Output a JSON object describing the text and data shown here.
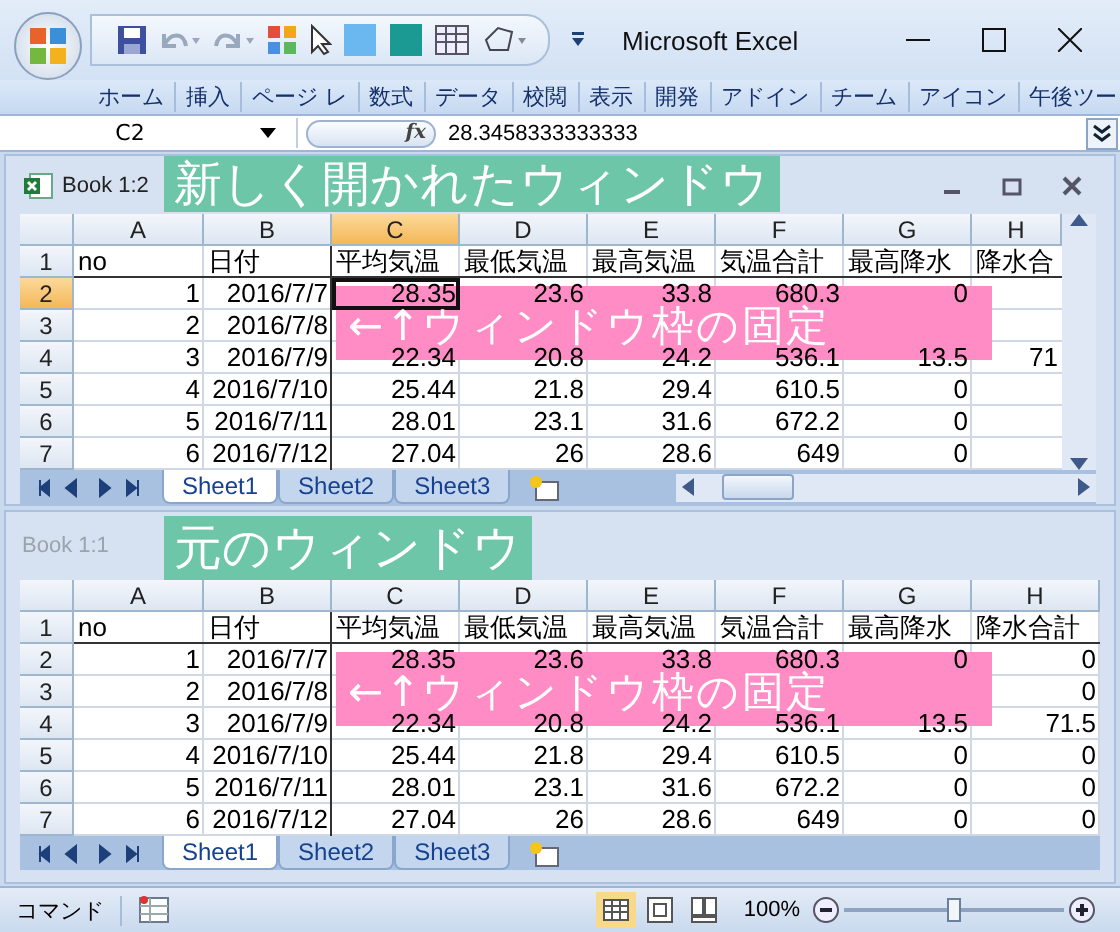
{
  "app": {
    "title": "Microsoft Excel"
  },
  "ribbon_tabs": [
    "ホーム",
    "挿入",
    "ページ レ",
    "数式",
    "データ",
    "校閲",
    "表示",
    "開発",
    "アドイン",
    "チーム",
    "アイコン",
    "午後ツー"
  ],
  "formula_bar": {
    "name_box": "C2",
    "fx": "fx",
    "value": "28.3458333333333"
  },
  "windows": [
    {
      "title": "Book 1:2",
      "active": true,
      "annotation": "新しく開かれたウィンドウ",
      "freeze_note": "←↑ウィンドウ枠の固定",
      "frozen_panes": true,
      "scrollbars": true,
      "columns": [
        {
          "label": "A",
          "selected": false
        },
        {
          "label": "B",
          "selected": false
        },
        {
          "label": "C",
          "selected": true
        },
        {
          "label": "D",
          "selected": false
        },
        {
          "label": "E",
          "selected": false
        },
        {
          "label": "F",
          "selected": false
        },
        {
          "label": "G",
          "selected": false
        },
        {
          "label": "H",
          "selected": false
        }
      ],
      "rows": [
        {
          "header": "1",
          "selected": false,
          "kind": "text",
          "cells": [
            "no",
            "日付",
            "平均気温",
            "最低気温",
            "最高気温",
            "気温合計",
            "最高降水",
            "降水合"
          ]
        },
        {
          "header": "2",
          "selected": true,
          "kind": "number",
          "cells": [
            "1",
            "2016/7/7",
            "28.35",
            "23.6",
            "33.8",
            "680.3",
            "0",
            null
          ]
        },
        {
          "header": "3",
          "selected": false,
          "kind": "number",
          "cells": [
            "2",
            "2016/7/8",
            null,
            null,
            null,
            null,
            null,
            null
          ]
        },
        {
          "header": "4",
          "selected": false,
          "kind": "number",
          "cells": [
            "3",
            "2016/7/9",
            "22.34",
            "20.8",
            "24.2",
            "536.1",
            "13.5",
            "71"
          ]
        },
        {
          "header": "5",
          "selected": false,
          "kind": "number",
          "cells": [
            "4",
            "2016/7/10",
            "25.44",
            "21.8",
            "29.4",
            "610.5",
            "0",
            null
          ]
        },
        {
          "header": "6",
          "selected": false,
          "kind": "number",
          "cells": [
            "5",
            "2016/7/11",
            "28.01",
            "23.1",
            "31.6",
            "672.2",
            "0",
            null
          ]
        },
        {
          "header": "7",
          "selected": false,
          "kind": "number",
          "cells": [
            "6",
            "2016/7/12",
            "27.04",
            "26",
            "28.6",
            "649",
            "0",
            null
          ]
        }
      ],
      "sheet_tabs": [
        {
          "label": "Sheet1",
          "selected": true
        },
        {
          "label": "Sheet2",
          "selected": false
        },
        {
          "label": "Sheet3",
          "selected": false
        }
      ]
    },
    {
      "title": "Book 1:1",
      "active": false,
      "annotation": "元のウィンドウ",
      "freeze_note": "←↑ウィンドウ枠の固定",
      "frozen_panes": true,
      "scrollbars": false,
      "columns": [
        {
          "label": "A",
          "selected": false
        },
        {
          "label": "B",
          "selected": false
        },
        {
          "label": "C",
          "selected": false
        },
        {
          "label": "D",
          "selected": false
        },
        {
          "label": "E",
          "selected": false
        },
        {
          "label": "F",
          "selected": false
        },
        {
          "label": "G",
          "selected": false
        },
        {
          "label": "H",
          "selected": false
        }
      ],
      "rows": [
        {
          "header": "1",
          "selected": false,
          "kind": "text",
          "cells": [
            "no",
            "日付",
            "平均気温",
            "最低気温",
            "最高気温",
            "気温合計",
            "最高降水",
            "降水合計"
          ]
        },
        {
          "header": "2",
          "selected": false,
          "kind": "number",
          "cells": [
            "1",
            "2016/7/7",
            "28.35",
            "23.6",
            "33.8",
            "680.3",
            "0",
            "0"
          ]
        },
        {
          "header": "3",
          "selected": false,
          "kind": "number",
          "cells": [
            "2",
            "2016/7/8",
            null,
            null,
            null,
            null,
            null,
            "0"
          ]
        },
        {
          "header": "4",
          "selected": false,
          "kind": "number",
          "cells": [
            "3",
            "2016/7/9",
            "22.34",
            "20.8",
            "24.2",
            "536.1",
            "13.5",
            "71.5"
          ]
        },
        {
          "header": "5",
          "selected": false,
          "kind": "number",
          "cells": [
            "4",
            "2016/7/10",
            "25.44",
            "21.8",
            "29.4",
            "610.5",
            "0",
            "0"
          ]
        },
        {
          "header": "6",
          "selected": false,
          "kind": "number",
          "cells": [
            "5",
            "2016/7/11",
            "28.01",
            "23.1",
            "31.6",
            "672.2",
            "0",
            "0"
          ]
        },
        {
          "header": "7",
          "selected": false,
          "kind": "number",
          "cells": [
            "6",
            "2016/7/12",
            "27.04",
            "26",
            "28.6",
            "649",
            "0",
            "0"
          ]
        }
      ],
      "sheet_tabs": [
        {
          "label": "Sheet1",
          "selected": true
        },
        {
          "label": "Sheet2",
          "selected": false
        },
        {
          "label": "Sheet3",
          "selected": false
        }
      ]
    }
  ],
  "status_bar": {
    "mode": "コマンド",
    "zoom": "100%",
    "zoom_slider": {
      "level": 0.5
    }
  }
}
